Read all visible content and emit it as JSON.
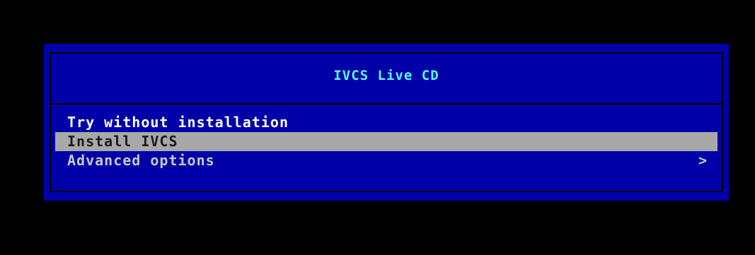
{
  "menu": {
    "title": "IVCS Live CD",
    "items": [
      {
        "label": "Try without installation",
        "selected": false
      },
      {
        "label": "Install IVCS",
        "selected": true
      },
      {
        "label": "Advanced options",
        "selected": false,
        "submenu_indicator": ">"
      }
    ]
  },
  "colors": {
    "background": "#000000",
    "panel": "#0000a8",
    "title": "#55ffff",
    "item_text": "#ffffff",
    "selected_bar": "#a8a8a8"
  }
}
